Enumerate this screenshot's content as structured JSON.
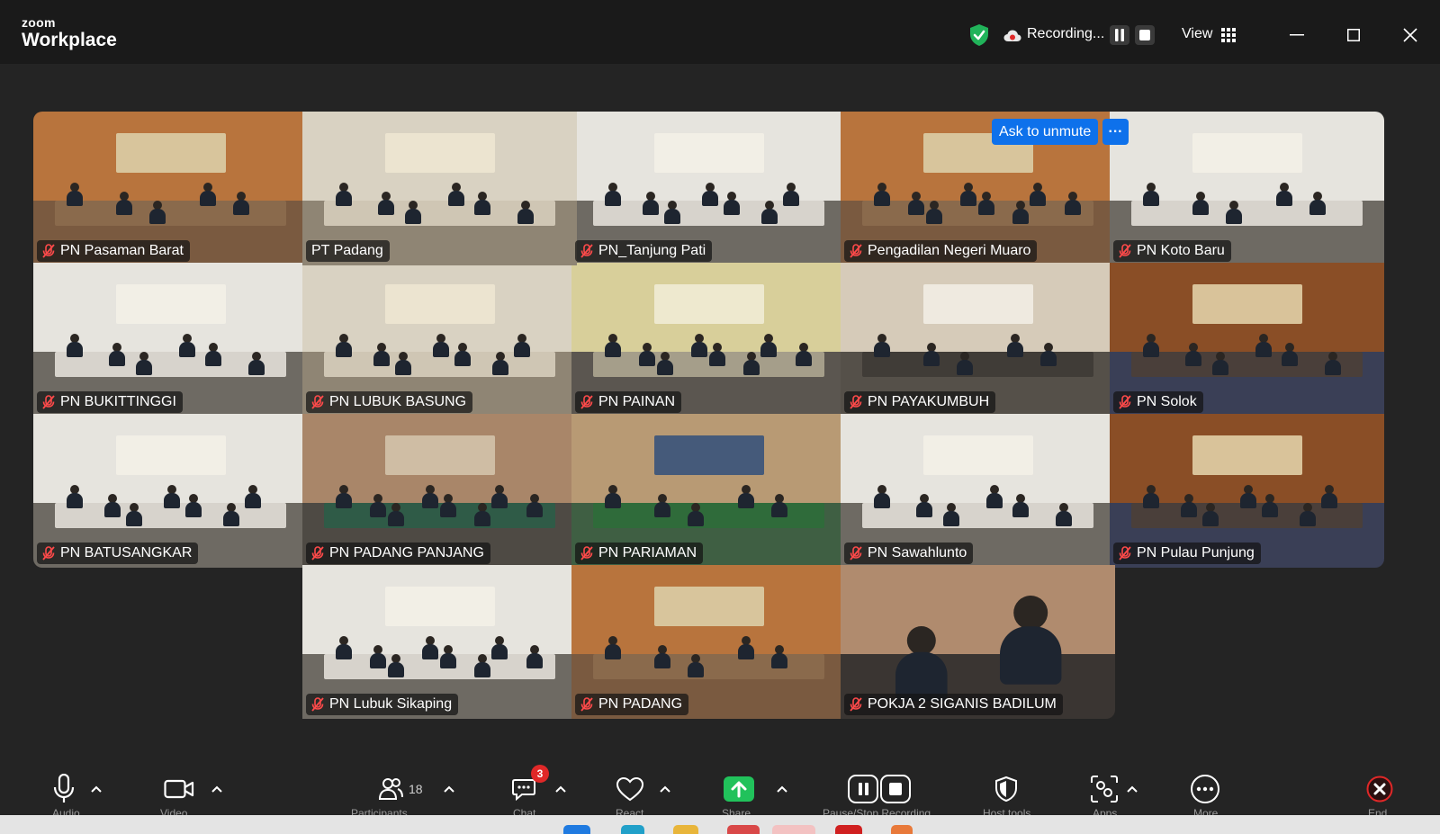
{
  "app": {
    "brand_top": "zoom",
    "brand_bottom": "Workplace"
  },
  "titlebar": {
    "recording_text": "Recording...",
    "view_label": "View",
    "pause_icon": "pause-icon",
    "stop_icon": "stop-icon",
    "security_icon": "shield-check-icon",
    "accent_green": "#21b35a"
  },
  "participants": [
    {
      "name": "PN Pasaman Barat",
      "muted": true,
      "scene": "orange"
    },
    {
      "name": "PT Padang",
      "muted": false,
      "active": true,
      "scene": "beige"
    },
    {
      "name": "PN_Tanjung Pati",
      "muted": true,
      "scene": "white"
    },
    {
      "name": "Pengadilan Negeri Muaro",
      "muted": true,
      "scene": "orange"
    },
    {
      "name": "PN Koto Baru",
      "muted": true,
      "scene": "white"
    },
    {
      "name": "PN BUKITTINGGI",
      "muted": true,
      "scene": "white"
    },
    {
      "name": "PN LUBUK BASUNG",
      "muted": true,
      "scene": "beige"
    },
    {
      "name": "PN PAINAN",
      "muted": true,
      "scene": "yellow"
    },
    {
      "name": "PN PAYAKUMBUH",
      "muted": true,
      "scene": "pattern"
    },
    {
      "name": "PN Solok",
      "muted": true,
      "scene": "wood"
    },
    {
      "name": "PN BATUSANGKAR",
      "muted": true,
      "scene": "white"
    },
    {
      "name": "PN PADANG PANJANG",
      "muted": true,
      "scene": "brown"
    },
    {
      "name": "PN PARIAMAN",
      "muted": true,
      "scene": "green"
    },
    {
      "name": "PN Sawahlunto",
      "muted": true,
      "scene": "white"
    },
    {
      "name": "PN Pulau Punjung",
      "muted": true,
      "scene": "wood"
    },
    {
      "name": "PN Lubuk Sikaping",
      "muted": true,
      "scene": "white"
    },
    {
      "name": "PN PADANG",
      "muted": true,
      "scene": "orange"
    },
    {
      "name": "POKJA 2 SIGANIS BADILUM",
      "muted": true,
      "scene": "closeup"
    }
  ],
  "hover_actions": {
    "ask_to_unmute": "Ask to unmute",
    "more_label": "···"
  },
  "toolbar": {
    "audio_label": "Audio",
    "video_label": "Video",
    "participants_label": "Participants",
    "participants_count": "18",
    "chat_label": "Chat",
    "chat_badge": "3",
    "react_label": "React",
    "share_label": "Share",
    "record_label": "Pause/Stop Recording",
    "host_tools_label": "Host tools",
    "apps_label": "Apps",
    "more_label": "More",
    "end_label": "End",
    "end_color": "#e02828",
    "share_color": "#21c25b"
  }
}
